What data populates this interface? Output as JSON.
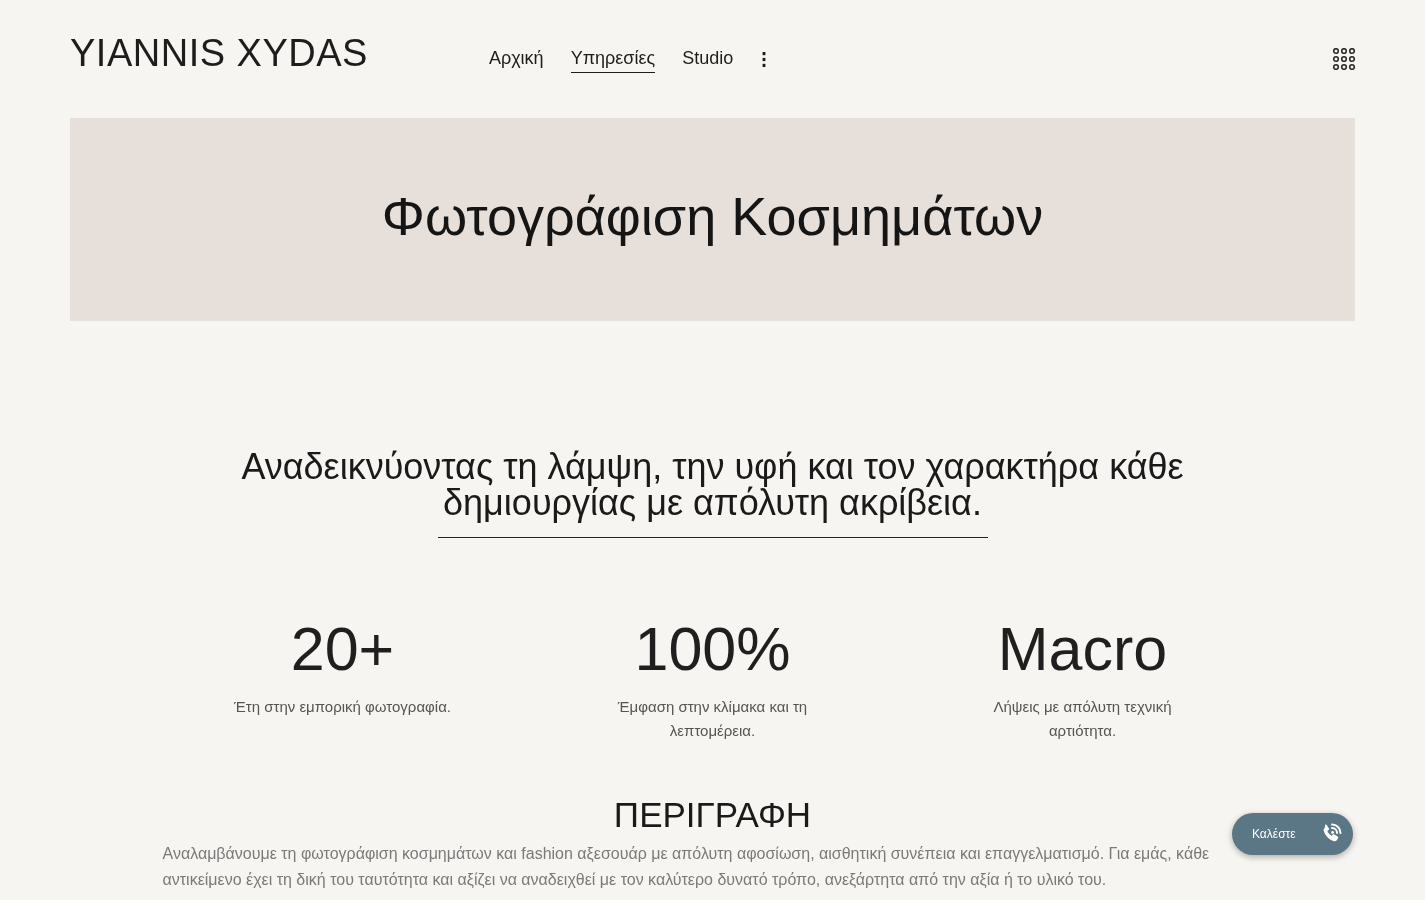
{
  "header": {
    "logo": "YIANNIS XYDAS",
    "nav": [
      {
        "label": "Αρχική",
        "selected": false
      },
      {
        "label": "Υπηρεσίες",
        "selected": true
      },
      {
        "label": "Studio",
        "selected": false
      }
    ]
  },
  "banner": {
    "title": "Φωτογράφιση Κοσμημάτων"
  },
  "intro": {
    "heading": "Αναδεικνύοντας τη λάμψη, την υφή και τον χαρακτήρα κάθε δημιουργίας με απόλυτη ακρίβεια."
  },
  "stats": [
    {
      "value": "20+",
      "caption": "Έτη στην εμπορική φωτογραφία."
    },
    {
      "value": "100%",
      "caption": "Έμφαση στην κλίμακα και τη λεπτομέρεια."
    },
    {
      "value": "Macro",
      "caption": "Λήψεις με απόλυτη τεχνική αρτιότητα."
    }
  ],
  "description": {
    "heading": "ΠΕΡΙΓΡΑΦΗ",
    "text": "Αναλαμβάνουμε τη φωτογράφιση κοσμημάτων και fashion αξεσουάρ με απόλυτη αφοσίωση, αισθητική συνέπεια και επαγγελματισμό. Για εμάς, κάθε αντικείμενο έχει τη δική του ταυτότητα και αξίζει να αναδειχθεί με τον καλύτερο δυνατό τρόπο, ανεξάρτητα από την αξία ή το υλικό του."
  },
  "call_button": {
    "label": "Καλέστε"
  }
}
